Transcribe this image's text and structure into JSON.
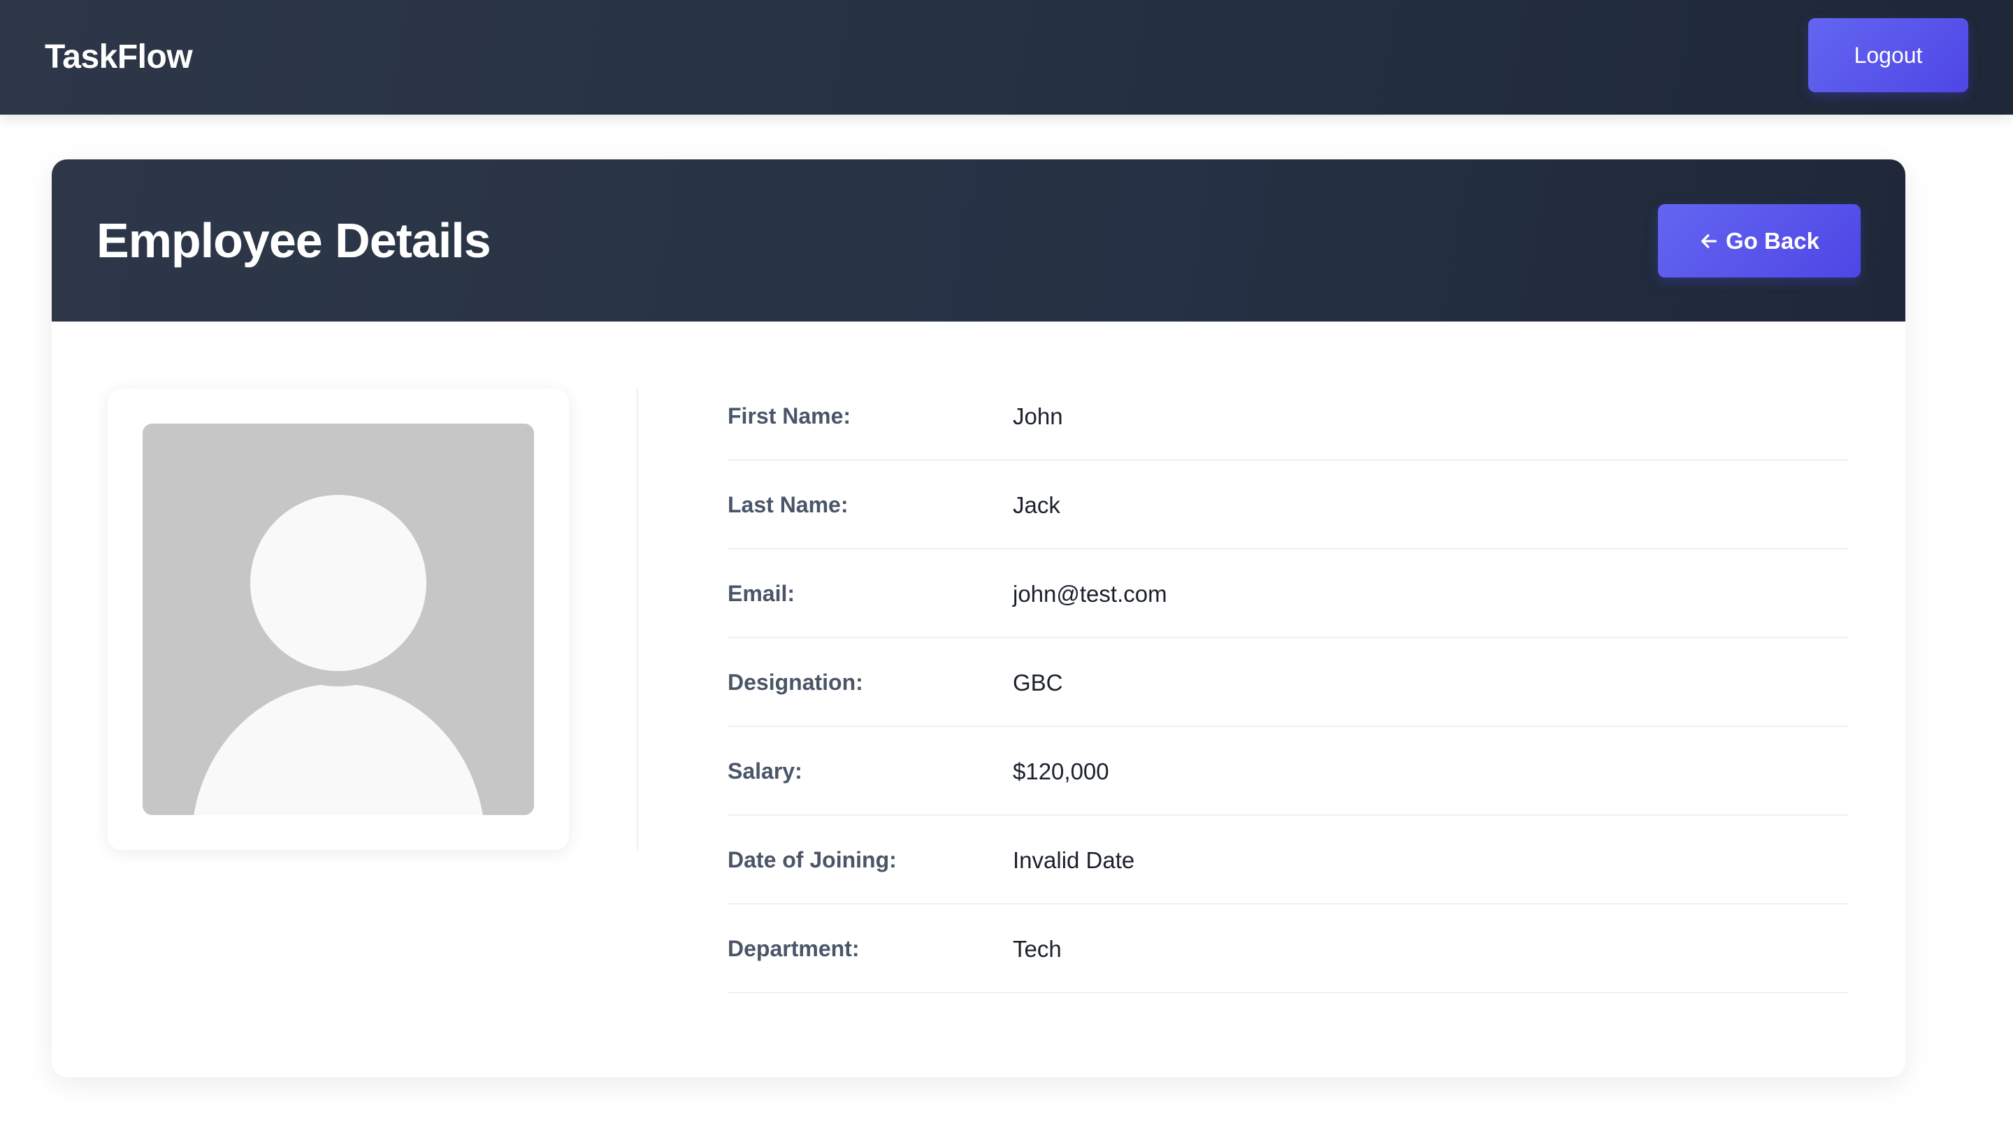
{
  "navbar": {
    "brand": "TaskFlow",
    "logout_label": "Logout"
  },
  "page": {
    "title": "Employee Details",
    "go_back_label": "Go Back",
    "go_back_icon": "arrow-left-icon"
  },
  "avatar": {
    "icon": "user-placeholder-icon"
  },
  "details": [
    {
      "label": "First Name:",
      "value": "John"
    },
    {
      "label": "Last Name:",
      "value": "Jack"
    },
    {
      "label": "Email:",
      "value": "john@test.com"
    },
    {
      "label": "Designation:",
      "value": "GBC"
    },
    {
      "label": "Salary:",
      "value": "$120,000"
    },
    {
      "label": "Date of Joining:",
      "value": "Invalid Date"
    },
    {
      "label": "Department:",
      "value": "Tech"
    }
  ],
  "colors": {
    "header_dark": "#2d3748",
    "accent": "#4f46e5",
    "label_text": "#4a5568",
    "value_text": "#1a202c"
  }
}
